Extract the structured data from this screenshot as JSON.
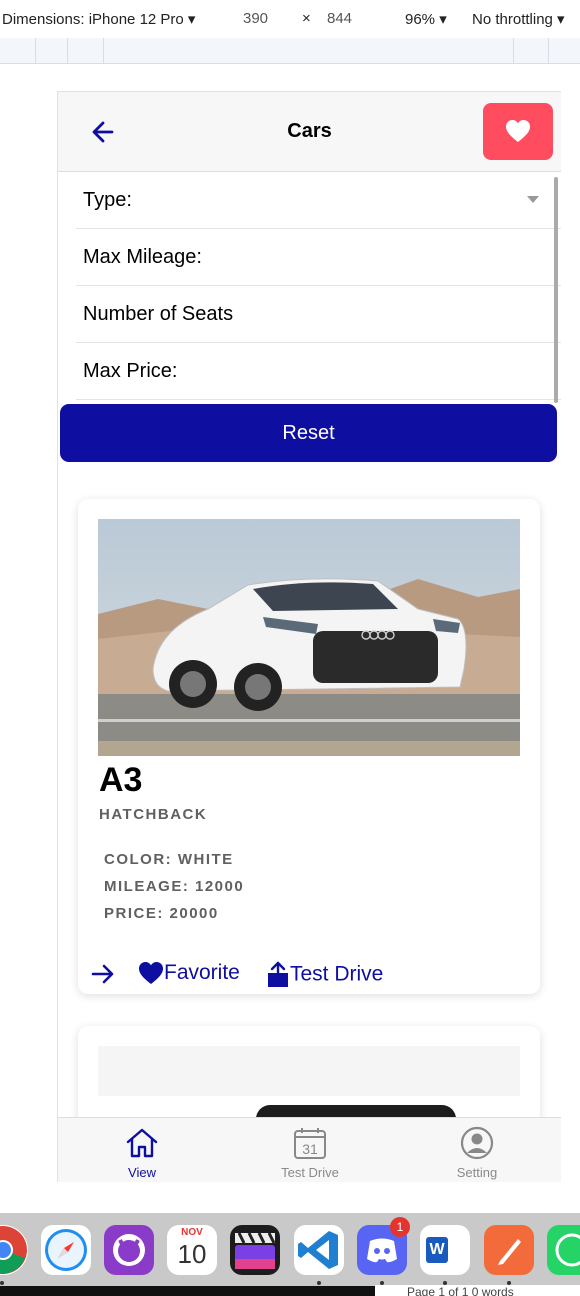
{
  "devtools": {
    "dimensions_label": "Dimensions: iPhone 12 Pro",
    "width": "390",
    "times": "×",
    "height": "844",
    "zoom": "96%",
    "throttle": "No throttling"
  },
  "appbar": {
    "title": "Cars",
    "back_icon": "arrow-left-icon",
    "favorite_icon": "heart-icon",
    "favorite_color": "#ff4c5e"
  },
  "filters": {
    "type_label": "Type:",
    "mileage_label": "Max Mileage:",
    "seats_label": "Number of Seats",
    "price_label": "Max Price:"
  },
  "reset_label": "Reset",
  "accent_color": "#0e0ea1",
  "car": {
    "model": "A3",
    "type": "HATCHBACK",
    "color": "COLOR: WHITE",
    "mileage": "MILEAGE: 12000",
    "price": "PRICE: 20000",
    "favorite_label": "Favorite",
    "test_drive_label": "Test Drive"
  },
  "tabs": [
    {
      "label": "View",
      "icon": "home-icon",
      "active": true
    },
    {
      "label": "Test Drive",
      "icon": "calendar-icon",
      "calendar_day": "31",
      "active": false
    },
    {
      "label": "Setting",
      "icon": "user-circle-icon",
      "active": false
    }
  ],
  "dock": {
    "calendar_month": "NOV",
    "calendar_day": "10",
    "discord_badge": "1",
    "word_letter": "W",
    "status_text": "Page 1 of 1    0 words"
  }
}
